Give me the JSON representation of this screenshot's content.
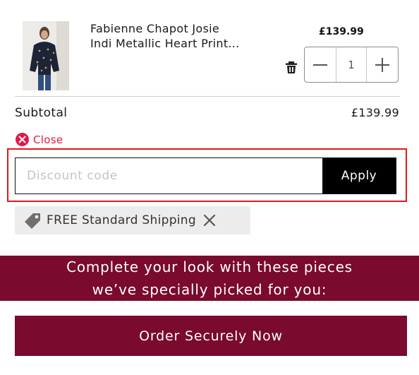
{
  "product": {
    "name_line1": "Fabienne Chapot Josie",
    "name_line2": "Indi Metallic Heart Print...",
    "price": "£139.99",
    "quantity": "1",
    "decrease_symbol": "minus-icon",
    "increase_symbol": "plus-icon",
    "remove_icon": "trash-icon"
  },
  "summary": {
    "subtotal_label": "Subtotal",
    "subtotal_value": "£139.99"
  },
  "discount": {
    "close_label": "Close",
    "placeholder": "Discount code",
    "value": "",
    "apply_label": "Apply"
  },
  "shipping": {
    "label": "FREE Standard Shipping"
  },
  "recommendations": {
    "line1": "Complete your look with these pieces",
    "line2": "we’ve specially picked for you:"
  },
  "checkout": {
    "button_label": "Order Securely Now"
  },
  "colors": {
    "brand": "#7a0a2e",
    "alert": "#e0184a",
    "highlight": "#e01919"
  }
}
